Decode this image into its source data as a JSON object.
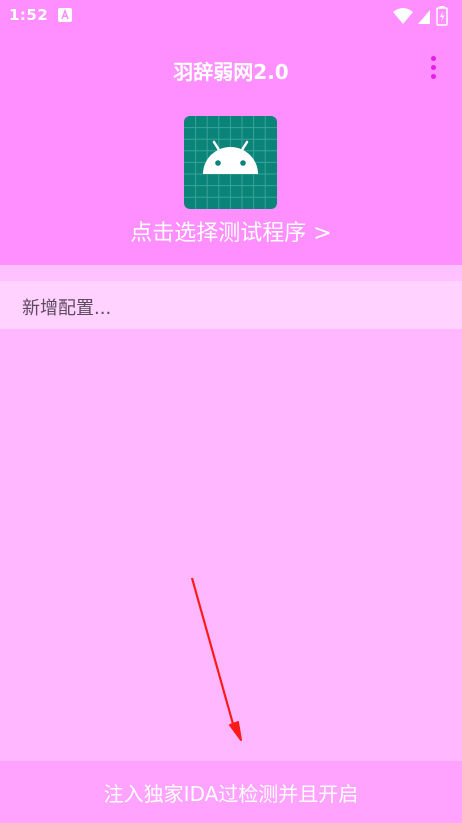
{
  "status_bar": {
    "time": "1:52",
    "icons": [
      "notification-a-icon",
      "wifi-icon",
      "cell-signal-icon",
      "battery-icon"
    ]
  },
  "header": {
    "title": "羽辞弱网2.0",
    "menu_icon": "overflow-menu-icon",
    "app_icon": "android-icon",
    "select_program": "点击选择测试程序 >"
  },
  "list": {
    "items": [
      {
        "label": "新增配置..."
      }
    ]
  },
  "bottom_button": {
    "label": "注入独家IDA过检测并且开启"
  },
  "colors": {
    "header_bg": "#ff8ffe",
    "content_bg": "#ffb8ff",
    "list_item_bg": "#ffd2ff",
    "bottom_button_bg": "#ffa3ff",
    "menu_dots": "#e61de6",
    "icon_bg": "#0a8379",
    "arrow": "#ff1a1a"
  }
}
